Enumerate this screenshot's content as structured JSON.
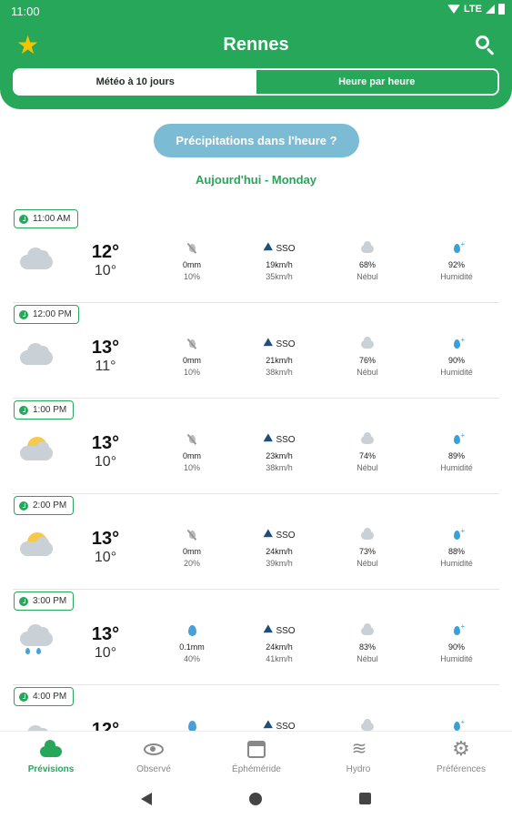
{
  "status": {
    "time": "11:00",
    "network": "LTE"
  },
  "header": {
    "city": "Rennes",
    "favorite_icon": "star-icon",
    "search_icon": "search-icon",
    "tabs": [
      {
        "label": "Météo à 10 jours",
        "active": false
      },
      {
        "label": "Heure par heure",
        "active": true
      }
    ]
  },
  "precip_button": "Précipitations dans l'heure ?",
  "day_label": "Aujourd'hui - Monday",
  "hours": [
    {
      "time": "11:00 AM",
      "icon": "cloudy-icon",
      "tmax": "12°",
      "tmin": "10°",
      "rain": "0mm",
      "rain_prob": "10%",
      "rain_icon": "no-rain-icon",
      "wind_dir": "SSO",
      "wind": "19km/h",
      "gust": "35km/h",
      "nebul": "68%",
      "nebul_label": "Nébul",
      "humidity": "92%",
      "humidity_label": "Humidité"
    },
    {
      "time": "12:00 PM",
      "icon": "cloudy-icon",
      "tmax": "13°",
      "tmin": "11°",
      "rain": "0mm",
      "rain_prob": "10%",
      "rain_icon": "no-rain-icon",
      "wind_dir": "SSO",
      "wind": "21km/h",
      "gust": "38km/h",
      "nebul": "76%",
      "nebul_label": "Nébul",
      "humidity": "90%",
      "humidity_label": "Humidité"
    },
    {
      "time": "1:00 PM",
      "icon": "partly-sunny-icon",
      "tmax": "13°",
      "tmin": "10°",
      "rain": "0mm",
      "rain_prob": "10%",
      "rain_icon": "no-rain-icon",
      "wind_dir": "SSO",
      "wind": "23km/h",
      "gust": "38km/h",
      "nebul": "74%",
      "nebul_label": "Nébul",
      "humidity": "89%",
      "humidity_label": "Humidité"
    },
    {
      "time": "2:00 PM",
      "icon": "partly-sunny-icon",
      "tmax": "13°",
      "tmin": "10°",
      "rain": "0mm",
      "rain_prob": "20%",
      "rain_icon": "no-rain-icon",
      "wind_dir": "SSO",
      "wind": "24km/h",
      "gust": "39km/h",
      "nebul": "73%",
      "nebul_label": "Nébul",
      "humidity": "88%",
      "humidity_label": "Humidité"
    },
    {
      "time": "3:00 PM",
      "icon": "light-rain-icon",
      "tmax": "13°",
      "tmin": "10°",
      "rain": "0.1mm",
      "rain_prob": "40%",
      "rain_icon": "rain-drop-icon",
      "wind_dir": "SSO",
      "wind": "24km/h",
      "gust": "41km/h",
      "nebul": "83%",
      "nebul_label": "Nébul",
      "humidity": "90%",
      "humidity_label": "Humidité"
    },
    {
      "time": "4:00 PM",
      "icon": "cloudy-icon",
      "tmax": "12°",
      "tmin": "",
      "rain": "",
      "rain_prob": "",
      "rain_icon": "rain-drop-icon",
      "wind_dir": "SSO",
      "wind": "",
      "gust": "",
      "nebul": "",
      "nebul_label": "",
      "humidity": "",
      "humidity_label": ""
    }
  ],
  "bottom_nav": [
    {
      "label": "Prévisions",
      "icon": "cloud-icon",
      "active": true
    },
    {
      "label": "Observé",
      "icon": "eye-icon",
      "active": false
    },
    {
      "label": "Éphéméride",
      "icon": "calendar-icon",
      "active": false
    },
    {
      "label": "Hydro",
      "icon": "waves-icon",
      "active": false
    },
    {
      "label": "Préférences",
      "icon": "gear-icon",
      "active": false
    }
  ],
  "colors": {
    "brand_green": "#27a75a",
    "star_yellow": "#f5c400",
    "precip_button": "#7bbcd4"
  }
}
